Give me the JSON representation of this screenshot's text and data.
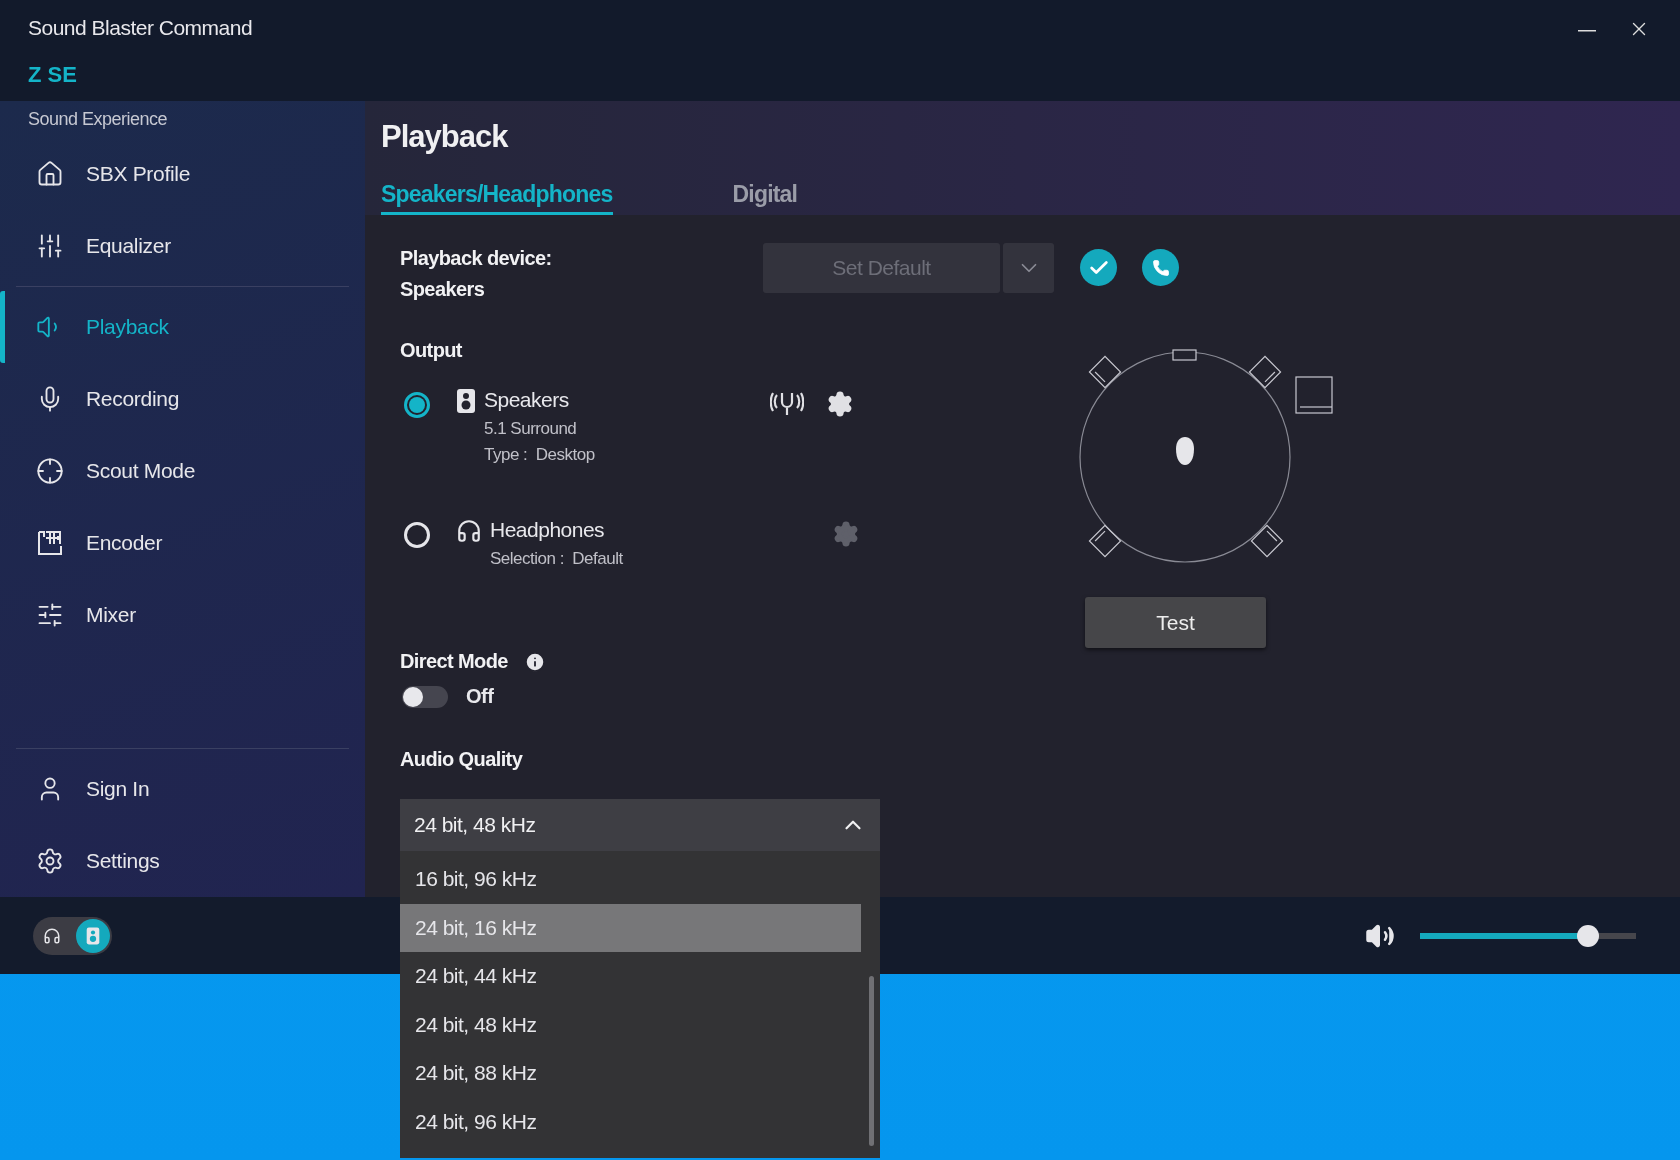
{
  "window": {
    "title": "Sound Blaster Command",
    "device": "Z SE"
  },
  "sidebar": {
    "section_label": "Sound Experience",
    "items": [
      {
        "label": "SBX Profile",
        "selected": false
      },
      {
        "label": "Equalizer",
        "selected": false
      },
      {
        "label": "Playback",
        "selected": true
      },
      {
        "label": "Recording",
        "selected": false
      },
      {
        "label": "Scout Mode",
        "selected": false
      },
      {
        "label": "Encoder",
        "selected": false
      },
      {
        "label": "Mixer",
        "selected": false
      }
    ],
    "footer_items": [
      {
        "label": "Sign In",
        "selected": false
      },
      {
        "label": "Settings",
        "selected": false
      }
    ]
  },
  "page": {
    "title": "Playback",
    "tabs": [
      {
        "label": "Speakers/Headphones",
        "selected": true
      },
      {
        "label": "Digital",
        "selected": false
      }
    ]
  },
  "playback_device": {
    "label": "Playback device:",
    "value": "Speakers",
    "button": "Set Default",
    "disabled": true
  },
  "output": {
    "heading": "Output",
    "options": [
      {
        "kind": "speakers",
        "name": "Speakers",
        "details": [
          "5.1 Surround",
          "Type :  Desktop"
        ],
        "selected": true
      },
      {
        "kind": "headphones",
        "name": "Headphones",
        "details": [
          "Selection :  Default"
        ],
        "selected": false
      }
    ]
  },
  "direct_mode": {
    "label": "Direct Mode",
    "on": false,
    "status": "Off"
  },
  "audio_quality": {
    "label": "Audio Quality",
    "value": "24 bit, 48 kHz",
    "expanded": true,
    "options": [
      {
        "label": "16 bit, 96 kHz",
        "highlighted": false
      },
      {
        "label": "24 bit, 16 kHz",
        "highlighted": true
      },
      {
        "label": "24 bit, 44 kHz",
        "highlighted": false
      },
      {
        "label": "24 bit, 48 kHz",
        "highlighted": false
      },
      {
        "label": "24 bit, 88 kHz",
        "highlighted": false
      },
      {
        "label": "24 bit, 96 kHz",
        "highlighted": false
      }
    ]
  },
  "speaker_test": {
    "button": "Test"
  },
  "bottom_bar": {
    "output_switch": [
      {
        "kind": "headphones",
        "selected": false
      },
      {
        "kind": "speakers",
        "selected": true
      }
    ],
    "volume": {
      "level": 0.78
    }
  }
}
